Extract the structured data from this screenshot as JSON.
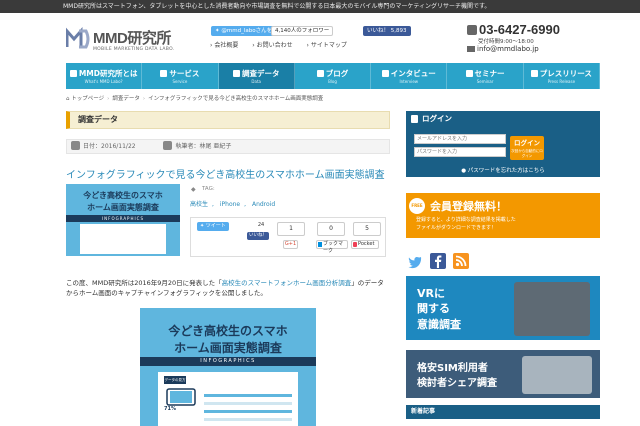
{
  "topbar": {
    "text": "MMD研究所はスマートフォン、タブレットを中心とした消費者動向や市場調査を無料で公開する日本最大のモバイル専門のマーケティングリサーチ機関です。"
  },
  "logo": {
    "name": "MMD研究所",
    "sub": "MOBILE MARKETING DATA LABO."
  },
  "header_social": {
    "twitter_follow": "@mmd_laboさんをフォロー",
    "twitter_followers": "4,140人のフォロワー",
    "fb_like": "いいね！ 5,893"
  },
  "header_links": [
    "会社概要",
    "お問い合わせ",
    "サイトマップ"
  ],
  "contact": {
    "phone": "03-6427-6990",
    "hours": "受付時間9:00～18:00",
    "email": "info@mmdlabo.jp"
  },
  "nav": [
    {
      "label": "MMD研究所とは",
      "sub": "What's MMD Labo?"
    },
    {
      "label": "サービス",
      "sub": "Service"
    },
    {
      "label": "調査データ",
      "sub": "Data"
    },
    {
      "label": "ブログ",
      "sub": "Blog"
    },
    {
      "label": "インタビュー",
      "sub": "Interview"
    },
    {
      "label": "セミナー",
      "sub": "Seminar"
    },
    {
      "label": "プレスリリース",
      "sub": "Press Release"
    }
  ],
  "breadcrumb": [
    "トップページ",
    "調査データ",
    "インフォグラフィックで見る今どき高校生のスマホホーム画面実態調査"
  ],
  "section_title": "調査データ",
  "meta": {
    "date": "日付：2016/11/22",
    "author": "執筆者：林尾 亜紀子"
  },
  "article": {
    "title": "インフォグラフィックで見る今どき高校生のスマホホーム画面実態調査",
    "tags_label": "TAG:",
    "tags": [
      "高校生",
      "iPhone",
      "Android"
    ],
    "body_before": "この度、MMD研究所は2016年9月20日に発表した「",
    "body_link": "高校生のスマートフォンホーム画面分析調査",
    "body_after": "」のデータからホーム画面のキャプチャインフォグラフィックを公開しました。"
  },
  "thumb": {
    "line1": "今どき高校生のスマホ",
    "line2": "ホーム画面実態調査",
    "band": "INFOGRAPHICS"
  },
  "share": {
    "tweet": "ツイート",
    "tw_count": "24",
    "fb_like": "いいね！",
    "fb_count": "1",
    "g_count": "0",
    "hb_count": "5",
    "gplus": "G+1",
    "hatena": "ブックマーク",
    "pocket": "Pocket"
  },
  "infographic": {
    "line1": "今どき高校生のスマホ",
    "line2": "ホーム画面実態調査",
    "band": "INFOGRAPHICS",
    "card_head": "データの見方",
    "pct": "71%"
  },
  "login": {
    "title": "ログイン",
    "email_placeholder": "メールアドレスを入力",
    "password_placeholder": "パスワードを入力",
    "button": "ログイン",
    "button_sub": "次回から自動的にログイン",
    "forgot": "パスワードを忘れた方はこちら"
  },
  "register": {
    "badge": "FREE",
    "title": "会員登録無料！",
    "desc1": "登録すると、より詳細な調査結果を掲載した",
    "desc2": "ファイルがダウンロードできます！"
  },
  "banner_vr": {
    "line1": "VRに",
    "line2": "関する",
    "line3": "意識調査"
  },
  "banner_sim": {
    "line1": "格安SIM利用者",
    "line2": "検討者シェア調査"
  },
  "recent_title": "新着記事",
  "colors": {
    "nav": "#2aa3c9",
    "nav_active": "#1a7fa6",
    "login": "#1a5f86",
    "accent": "#f39800",
    "link": "#2a8ab8"
  }
}
